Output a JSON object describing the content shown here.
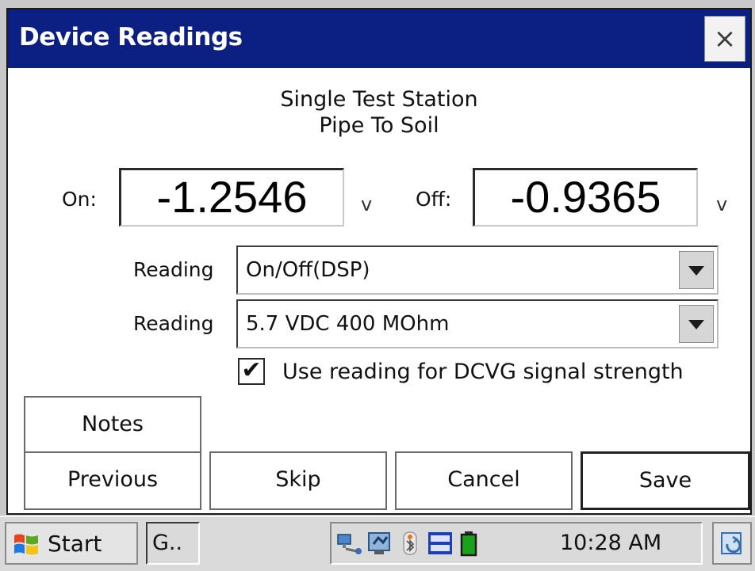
{
  "window": {
    "title": "Device Readings",
    "close_label": "×"
  },
  "heading": {
    "line1": "Single Test Station",
    "line2": "Pipe To Soil"
  },
  "readings": {
    "on_label": "On:",
    "on_value": "-1.2546",
    "on_unit": "v",
    "off_label": "Off:",
    "off_value": "-0.9365",
    "off_unit": "v"
  },
  "selects": [
    {
      "label": "Reading",
      "value": "On/Off(DSP)"
    },
    {
      "label": "Reading",
      "value": "5.7 VDC 400 MOhm"
    }
  ],
  "checkbox": {
    "label": "Use reading for DCVG signal strength",
    "checked": true,
    "mark": "✔"
  },
  "buttons": {
    "notes": "Notes",
    "previous": "Previous",
    "skip": "Skip",
    "cancel": "Cancel",
    "save": "Save"
  },
  "taskbar": {
    "start": "Start",
    "app": "G..",
    "clock": "10:28 AM"
  },
  "colors": {
    "titlebar": "#0c1f82",
    "battery": "#1aa31a"
  }
}
